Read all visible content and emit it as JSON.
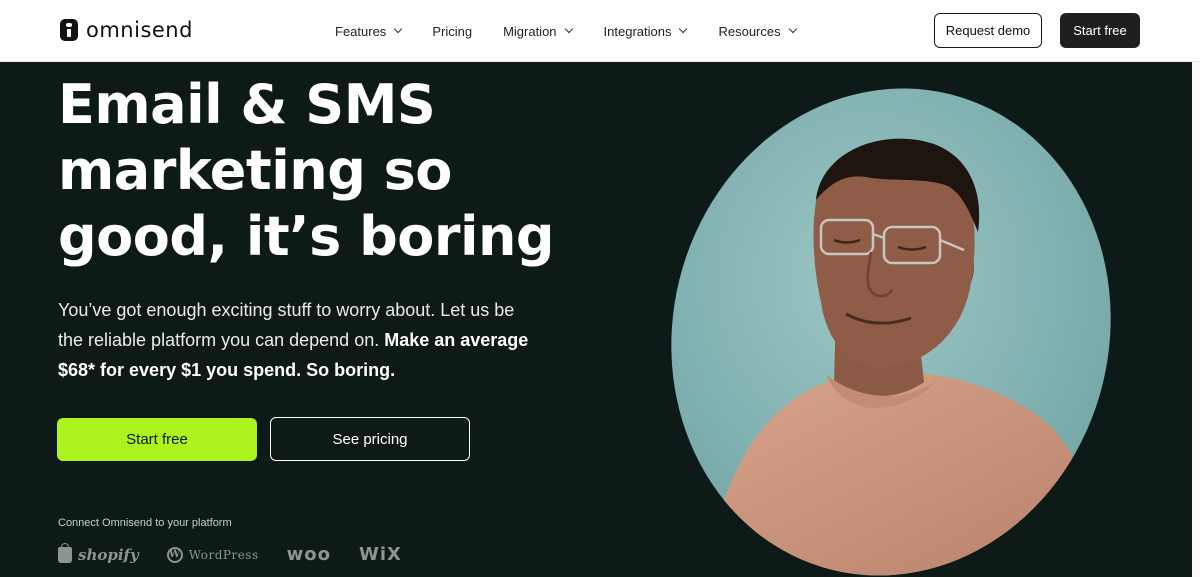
{
  "brand": {
    "name": "omnisend",
    "logo_icon": "omnisend-logo-icon"
  },
  "nav": {
    "items": [
      {
        "label": "Features",
        "has_dropdown": true
      },
      {
        "label": "Pricing",
        "has_dropdown": false
      },
      {
        "label": "Migration",
        "has_dropdown": true
      },
      {
        "label": "Integrations",
        "has_dropdown": true
      },
      {
        "label": "Resources",
        "has_dropdown": true
      }
    ],
    "request_demo": "Request demo",
    "start_free": "Start free"
  },
  "hero": {
    "headline_lines": [
      "Email & SMS",
      "marketing so",
      "good, it’s boring"
    ],
    "sub_plain": "You’ve got enough exciting stuff to worry about. Let us be the reliable platform you can depend on. ",
    "sub_strong": "Make an average $68* for every $1 you spend. So boring.",
    "cta_primary": "Start free",
    "cta_secondary": "See pricing",
    "connect_label": "Connect Omnisend to your platform",
    "platforms": [
      "shopify",
      "WordPress",
      "woo",
      "WiX"
    ]
  },
  "colors": {
    "hero_bg": "#0d1a17",
    "accent": "#adf31d",
    "portrait_bg": "#8ab8b8",
    "nav_button_dark": "#1f1f1f"
  }
}
